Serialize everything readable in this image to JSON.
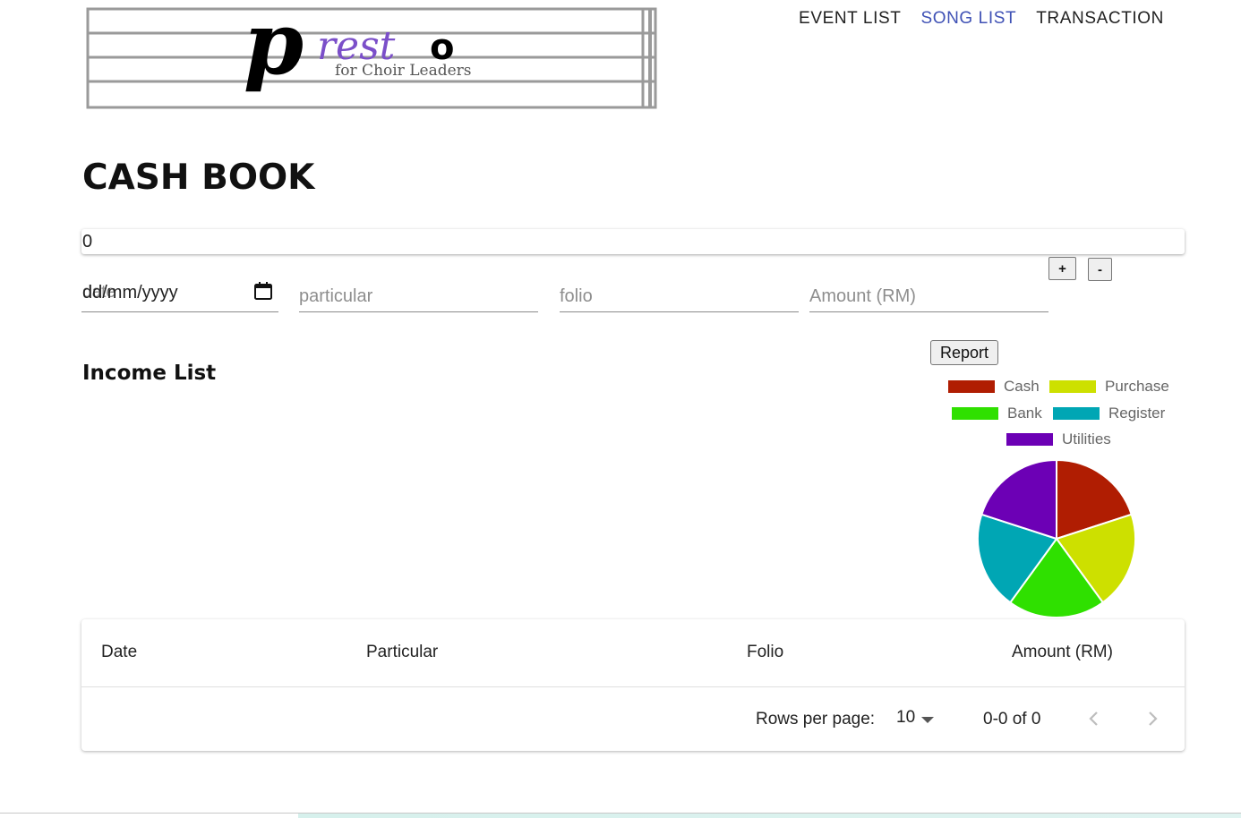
{
  "logo": {
    "main_text": "presto",
    "sub_text": "for Choir Leaders"
  },
  "nav": {
    "items": [
      {
        "label": "EVENT LIST",
        "active": false
      },
      {
        "label": "SONG LIST",
        "active": true
      },
      {
        "label": "TRANSACTION",
        "active": false
      }
    ],
    "active_color": "#3f51b5"
  },
  "page_title": "CASH BOOK",
  "balance": {
    "value": "0"
  },
  "form": {
    "date_label": "date",
    "date_value": "dd/mm/yyyy",
    "particular_placeholder": "particular",
    "folio_placeholder": "folio",
    "amount_placeholder": "Amount (RM)",
    "plus_label": "+",
    "minus_label": "-"
  },
  "income_section": {
    "title": "Income List"
  },
  "report": {
    "button_label": "Report"
  },
  "chart_data": {
    "type": "pie",
    "labels": [
      "Cash",
      "Purchase",
      "Bank",
      "Register",
      "Utilities"
    ],
    "values": [
      1,
      1,
      1,
      1,
      1
    ],
    "colors": [
      "#b01d02",
      "#cde000",
      "#2fe000",
      "#00a6b4",
      "#6c00b5"
    ],
    "legend_position": "top"
  },
  "table": {
    "columns": [
      "Date",
      "Particular",
      "Folio",
      "Amount (RM)"
    ],
    "rows": [],
    "rows_per_page_label": "Rows per page:",
    "rows_per_page_value": "10",
    "range_text": "0-0 of 0"
  },
  "icons": {
    "calendar": "calendar-icon",
    "dropdown": "caret-down-icon",
    "prev": "chevron-left-icon",
    "next": "chevron-right-icon"
  }
}
